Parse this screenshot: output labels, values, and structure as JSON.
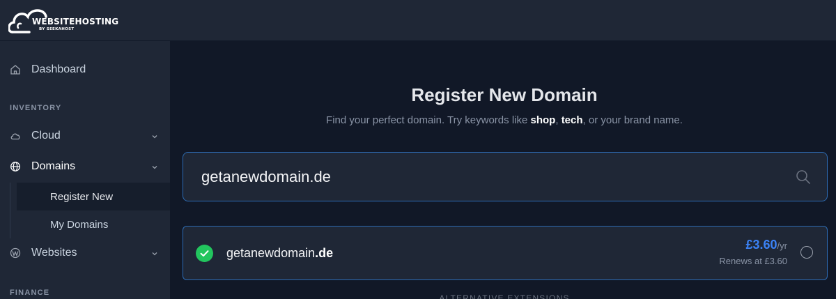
{
  "brand": {
    "name": "WEBSITEHOSTING",
    "by": "BY",
    "sub": "SEEKAHOST"
  },
  "sidebar": {
    "dashboard": "Dashboard",
    "inventory_label": "INVENTORY",
    "cloud": "Cloud",
    "domains": "Domains",
    "register_new": "Register New",
    "my_domains": "My Domains",
    "websites": "Websites",
    "finance_label": "FINANCE"
  },
  "main": {
    "title": "Register New Domain",
    "subtitle_pre": "Find your perfect domain. Try keywords like ",
    "kw1": "shop",
    "sep": ", ",
    "kw2": "tech",
    "subtitle_post": ", or your brand name.",
    "search_value": "getanewdomain.de",
    "result": {
      "domain_base": "getanewdomain",
      "domain_ext": ".de",
      "price": "£3.60",
      "per": "/yr",
      "renews": "Renews at £3.60"
    },
    "alt_label": "ALTERNATIVE EXTENSIONS"
  },
  "colors": {
    "accent": "#3b82f6",
    "success": "#22c55e",
    "background": "#111827",
    "panel": "#1f2736"
  }
}
